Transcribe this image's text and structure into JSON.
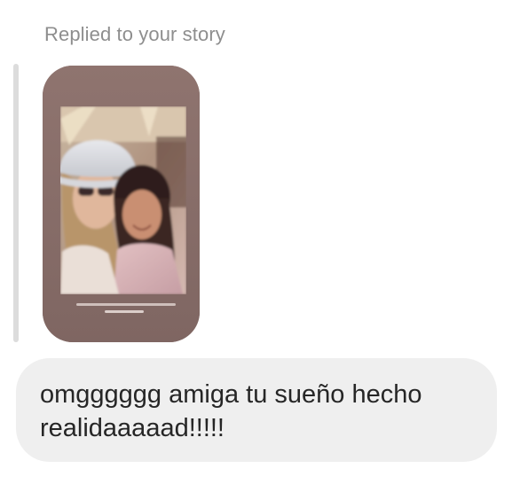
{
  "reply": {
    "header_text": "Replied to your story"
  },
  "story": {
    "icon": "story-photo-thumbnail",
    "background_color": "#8a6f6c"
  },
  "message": {
    "text": "omgggggg amiga tu sueño hecho\nrealidaaaaad!!!!!"
  },
  "colors": {
    "header_text": "#8e8e8e",
    "quote_bar": "#dcdcdc",
    "bubble": "#efefef",
    "message_text": "#262626"
  }
}
